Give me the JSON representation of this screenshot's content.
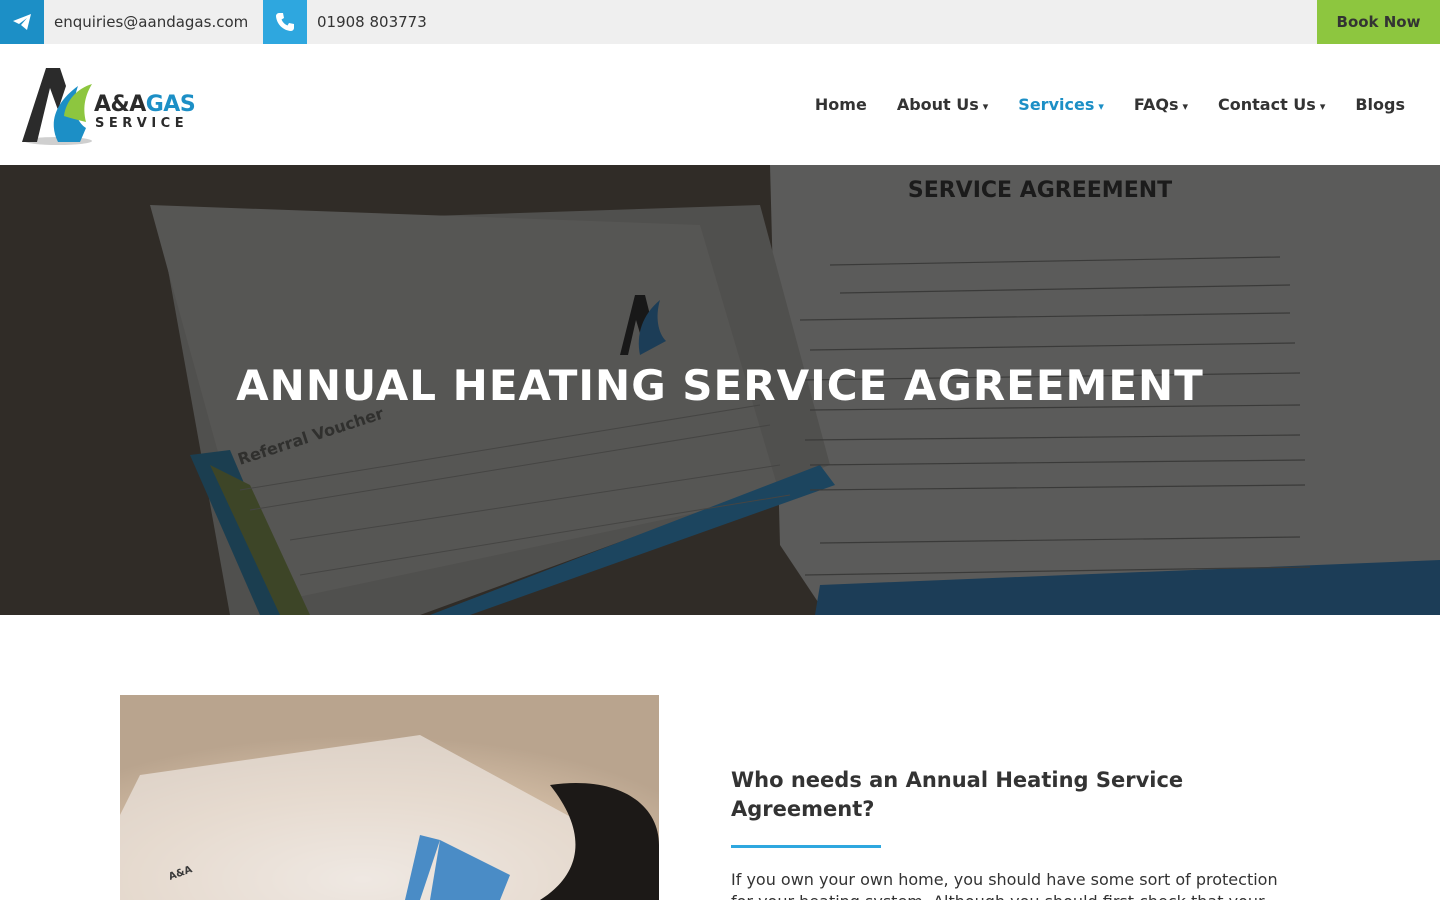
{
  "topbar": {
    "email": "enquiries@aandagas.com",
    "phone": "01908 803773",
    "book_now": "Book Now",
    "email_icon": "paper-plane-icon",
    "phone_icon": "phone-icon"
  },
  "brand": {
    "name_part1": "A&A",
    "name_part2": "GAS",
    "tagline": "SERVICE",
    "colors": {
      "blue": "#1c8fc6",
      "green": "#8dc63f",
      "dark": "#2b2b2b"
    }
  },
  "nav": {
    "items": [
      {
        "label": "Home",
        "dropdown": false,
        "active": false
      },
      {
        "label": "About Us",
        "dropdown": true,
        "active": false
      },
      {
        "label": "Services",
        "dropdown": true,
        "active": true
      },
      {
        "label": "FAQs",
        "dropdown": true,
        "active": false
      },
      {
        "label": "Contact Us",
        "dropdown": true,
        "active": false
      },
      {
        "label": "Blogs",
        "dropdown": false,
        "active": false
      }
    ],
    "caret": "▾"
  },
  "hero": {
    "title": "ANNUAL HEATING SERVICE AGREEMENT",
    "doc_heading": "SERVICE AGREEMENT",
    "voucher_heading": "Referral Voucher"
  },
  "content": {
    "heading": "Who needs an Annual Heating Service Agreement?",
    "body": "If you own your own home, you should have some sort of protection for your heating system.  Although you should first check that your boiler is"
  }
}
